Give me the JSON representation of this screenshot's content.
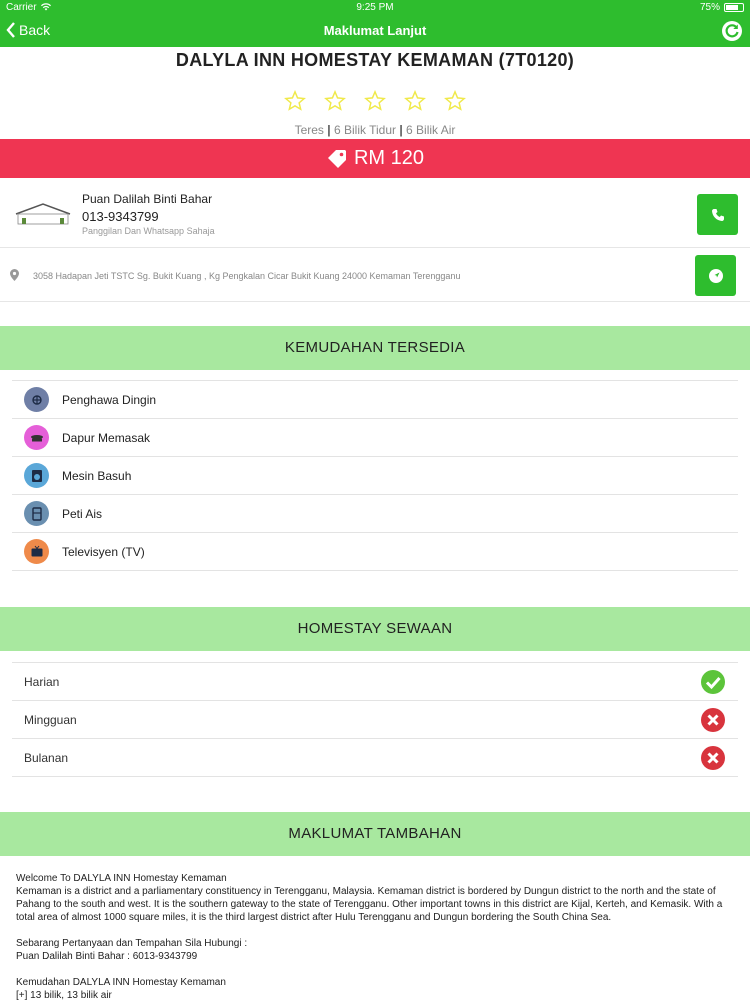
{
  "status": {
    "carrier": "Carrier",
    "time": "9:25 PM",
    "battery": "75%",
    "battery_level": 0.75
  },
  "nav": {
    "back_label": "Back",
    "title": "Maklumat Lanjut"
  },
  "listing": {
    "title": "DALYLA INN HOMESTAY KEMAMAN (7T0120)",
    "rating_stars": 5,
    "type": "Teres",
    "bedrooms": "6 Bilik Tidur",
    "bathrooms": "6 Bilik Air",
    "price": "RM 120"
  },
  "contact": {
    "logo_text": "HOMESTAY",
    "name": "Puan Dalilah Binti Bahar",
    "phone": "013-9343799",
    "note": "Panggilan Dan Whatsapp Sahaja",
    "address": "3058 Hadapan Jeti TSTC Sg. Bukit Kuang , Kg Pengkalan Cicar Bukit Kuang 24000 Kemaman Terengganu"
  },
  "facilities": {
    "heading": "KEMUDAHAN TERSEDIA",
    "items": [
      {
        "label": "Penghawa Dingin",
        "icon": "air-conditioner-icon",
        "color": "#6f7fa6"
      },
      {
        "label": "Dapur Memasak",
        "icon": "stove-icon",
        "color": "#e55fd8"
      },
      {
        "label": "Mesin Basuh",
        "icon": "washing-machine-icon",
        "color": "#5aa7d8"
      },
      {
        "label": "Peti Ais",
        "icon": "fridge-icon",
        "color": "#6a8fb0"
      },
      {
        "label": "Televisyen (TV)",
        "icon": "tv-icon",
        "color": "#ef8a4a"
      }
    ]
  },
  "rental": {
    "heading": "HOMESTAY SEWAAN",
    "items": [
      {
        "label": "Harian",
        "available": true
      },
      {
        "label": "Mingguan",
        "available": false
      },
      {
        "label": "Bulanan",
        "available": false
      }
    ]
  },
  "extra": {
    "heading": "MAKLUMAT TAMBAHAN",
    "line1": "Welcome To DALYLA INN Homestay Kemaman",
    "line2": "Kemaman is a district and a parliamentary constituency in Terengganu, Malaysia. Kemaman district is bordered by Dungun district to the north and the state of Pahang to the south and west. It is the southern gateway to the state of Terengganu. Other important towns in this district are Kijal, Kerteh, and Kemasik. With a total area of almost 1000 square miles, it is the third largest district after Hulu Terengganu and Dungun bordering the South China Sea.",
    "line3": "Sebarang Pertanyaan dan Tempahan Sila Hubungi :",
    "line4": "Puan Dalilah Binti Bahar : 6013-9343799",
    "line5": "Kemudahan DALYLA INN Homestay Kemaman",
    "line6": "[+] 13 bilik, 13 bilik air"
  },
  "colors": {
    "accent": "#2ebd2e",
    "price_bar": "#ef3552",
    "section_bg": "#a8e89f",
    "ok": "#5cc43a",
    "no": "#d8343d"
  }
}
